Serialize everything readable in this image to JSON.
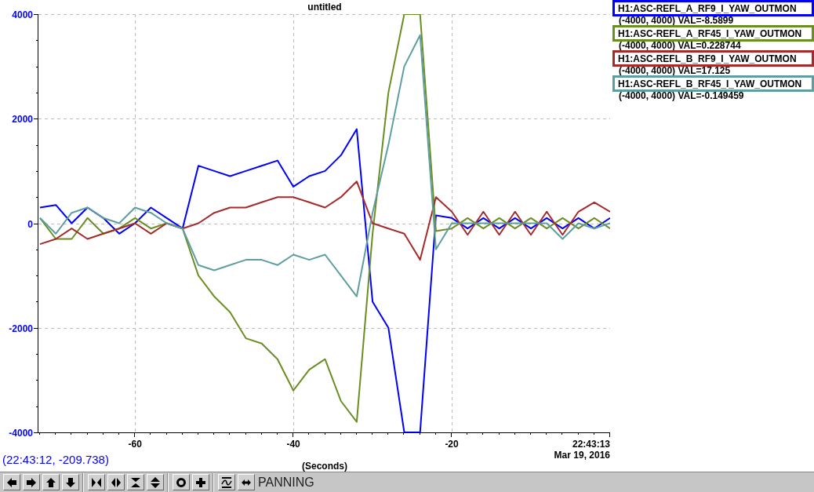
{
  "plot": {
    "chart_data": {
      "type": "line",
      "title": "untitled",
      "xlabel": "(Seconds)",
      "grid": true,
      "x": [
        -72,
        -70,
        -68,
        -66,
        -64,
        -62,
        -60,
        -58,
        -56,
        -54,
        -52,
        -50,
        -48,
        -46,
        -44,
        -42,
        -40,
        -38,
        -36,
        -34,
        -32,
        -30,
        -28,
        -26,
        -24,
        -22,
        -20,
        -18,
        -16,
        -14,
        -12,
        -10,
        -8,
        -6,
        -4,
        -2,
        0
      ],
      "series": [
        {
          "name": "H1:ASC-REFL_A_RF9_I_YAW_OUTMON",
          "color": "#0000ff",
          "values": [
            300,
            350,
            0,
            300,
            100,
            -200,
            0,
            300,
            100,
            -100,
            1100,
            1000,
            900,
            1000,
            1100,
            1200,
            700,
            900,
            1000,
            1300,
            1800,
            -1500,
            -2000,
            -4000,
            -4000,
            150,
            100,
            -100,
            100,
            -100,
            100,
            -100,
            100,
            -100,
            100,
            -100,
            100
          ]
        },
        {
          "name": "H1:ASC-REFL_A_RF45_I_YAW_OUTMON",
          "color": "#6b8e23",
          "values": [
            100,
            -300,
            -300,
            100,
            -200,
            -100,
            100,
            -100,
            0,
            -100,
            -1000,
            -1400,
            -1700,
            -2200,
            -2300,
            -2600,
            -3200,
            -2800,
            -2600,
            -3400,
            -3800,
            -200,
            2500,
            4000,
            4000,
            -150,
            -100,
            100,
            -100,
            100,
            -100,
            100,
            -100,
            100,
            -100,
            100,
            -100
          ]
        },
        {
          "name": "H1:ASC-REFL_B_RF9_I_YAW_OUTMON",
          "color": "#a52a2a",
          "values": [
            -400,
            -300,
            -100,
            -300,
            -200,
            -100,
            0,
            -200,
            0,
            -100,
            0,
            200,
            300,
            300,
            400,
            500,
            500,
            400,
            300,
            500,
            800,
            0,
            -100,
            -200,
            -700,
            500,
            220,
            -220,
            220,
            -220,
            220,
            -220,
            220,
            -220,
            220,
            400,
            220
          ]
        },
        {
          "name": "H1:ASC-REFL_B_RF45_I_YAW_OUTMON",
          "color": "#5f9ea0",
          "values": [
            100,
            -200,
            200,
            300,
            100,
            0,
            300,
            200,
            0,
            -100,
            -800,
            -900,
            -800,
            -700,
            -700,
            -800,
            -600,
            -700,
            -600,
            -1000,
            -1400,
            200,
            1500,
            3000,
            3600,
            -500,
            0,
            0,
            0,
            0,
            0,
            0,
            0,
            -300,
            0,
            -100,
            0
          ]
        }
      ],
      "xlim": [
        -72.2,
        0
      ],
      "ylim": [
        -4000,
        4000
      ],
      "xticks": [
        -60,
        -40,
        -20,
        {
          "value": 0,
          "label": "22:43:13\nMar 19, 2016"
        }
      ],
      "yticks": [
        -4000,
        -2000,
        0,
        2000,
        4000
      ]
    }
  },
  "legend": [
    {
      "readout": "(-4000, 4000) VAL=-8.5899"
    },
    {
      "readout": "(-4000, 4000) VAL=0.228744"
    },
    {
      "readout": "(-4000, 4000) VAL=17.125"
    },
    {
      "readout": "(-4000, 4000) VAL=-0.149459"
    }
  ],
  "cursor_readout": "(22:43:12, -209.738)",
  "toolbar": {
    "mode": "PANNING"
  }
}
